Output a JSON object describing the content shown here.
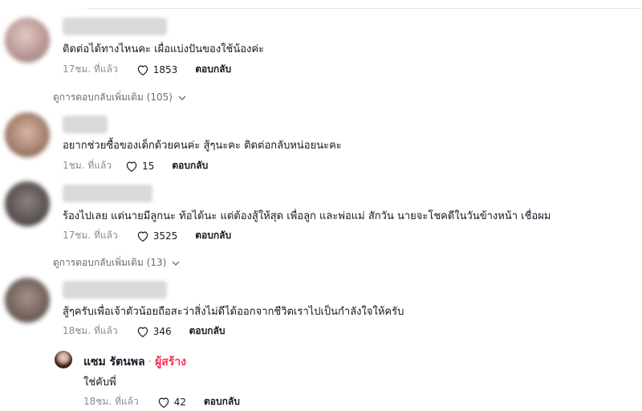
{
  "comments": [
    {
      "text": "ติดต่อได้ทางไหนคะ เผื่อแบ่งปันของใช้น้องค่ะ",
      "time": "17ชม. ที่แล้ว",
      "likes": "1853",
      "reply": "ตอบกลับ",
      "more_replies": "ดูการตอบกลับเพิ่มเติม (105)"
    },
    {
      "text": "อยากช่วยซื้อของเด็กด้วยคนค่ะ สู้ๆนะคะ ติดต่อกลับหน่อยนะคะ",
      "time": "1ชม. ที่แล้ว",
      "likes": "15",
      "reply": "ตอบกลับ"
    },
    {
      "text": "ร้องไปเลย แต่นายมีลูกนะ ท้อได้นะ แต่ต้องสู้ให้สุด เพื่อลูก และพ่อแม่ สักวัน นายจะโชคดีในวันข้างหน้า เชื่อผม",
      "time": "17ชม. ที่แล้ว",
      "likes": "3525",
      "reply": "ตอบกลับ",
      "more_replies": "ดูการตอบกลับเพิ่มเติม (13)"
    },
    {
      "text": "สู้ๆครับเพื่อเจ้าตัวน้อยถือสะว่าสิ่งไม่ดีได้ออกจากชีวิตเราไปเป็นกำลังใจให้ครับ",
      "time": "18ชม. ที่แล้ว",
      "likes": "346",
      "reply": "ตอบกลับ"
    }
  ],
  "creator_reply": {
    "name": "แซม รัตนพล",
    "separator": "·",
    "badge": "ผู้สร้าง",
    "text": "ใช่คับพี่",
    "time": "18ชม. ที่แล้ว",
    "likes": "42",
    "reply": "ตอบกลับ"
  },
  "icons": {
    "like": "heart-outline-icon",
    "expand": "chevron-down-icon"
  },
  "colors": {
    "creator_badge": "#fe2c55",
    "meta_text": "#8a8b91"
  }
}
